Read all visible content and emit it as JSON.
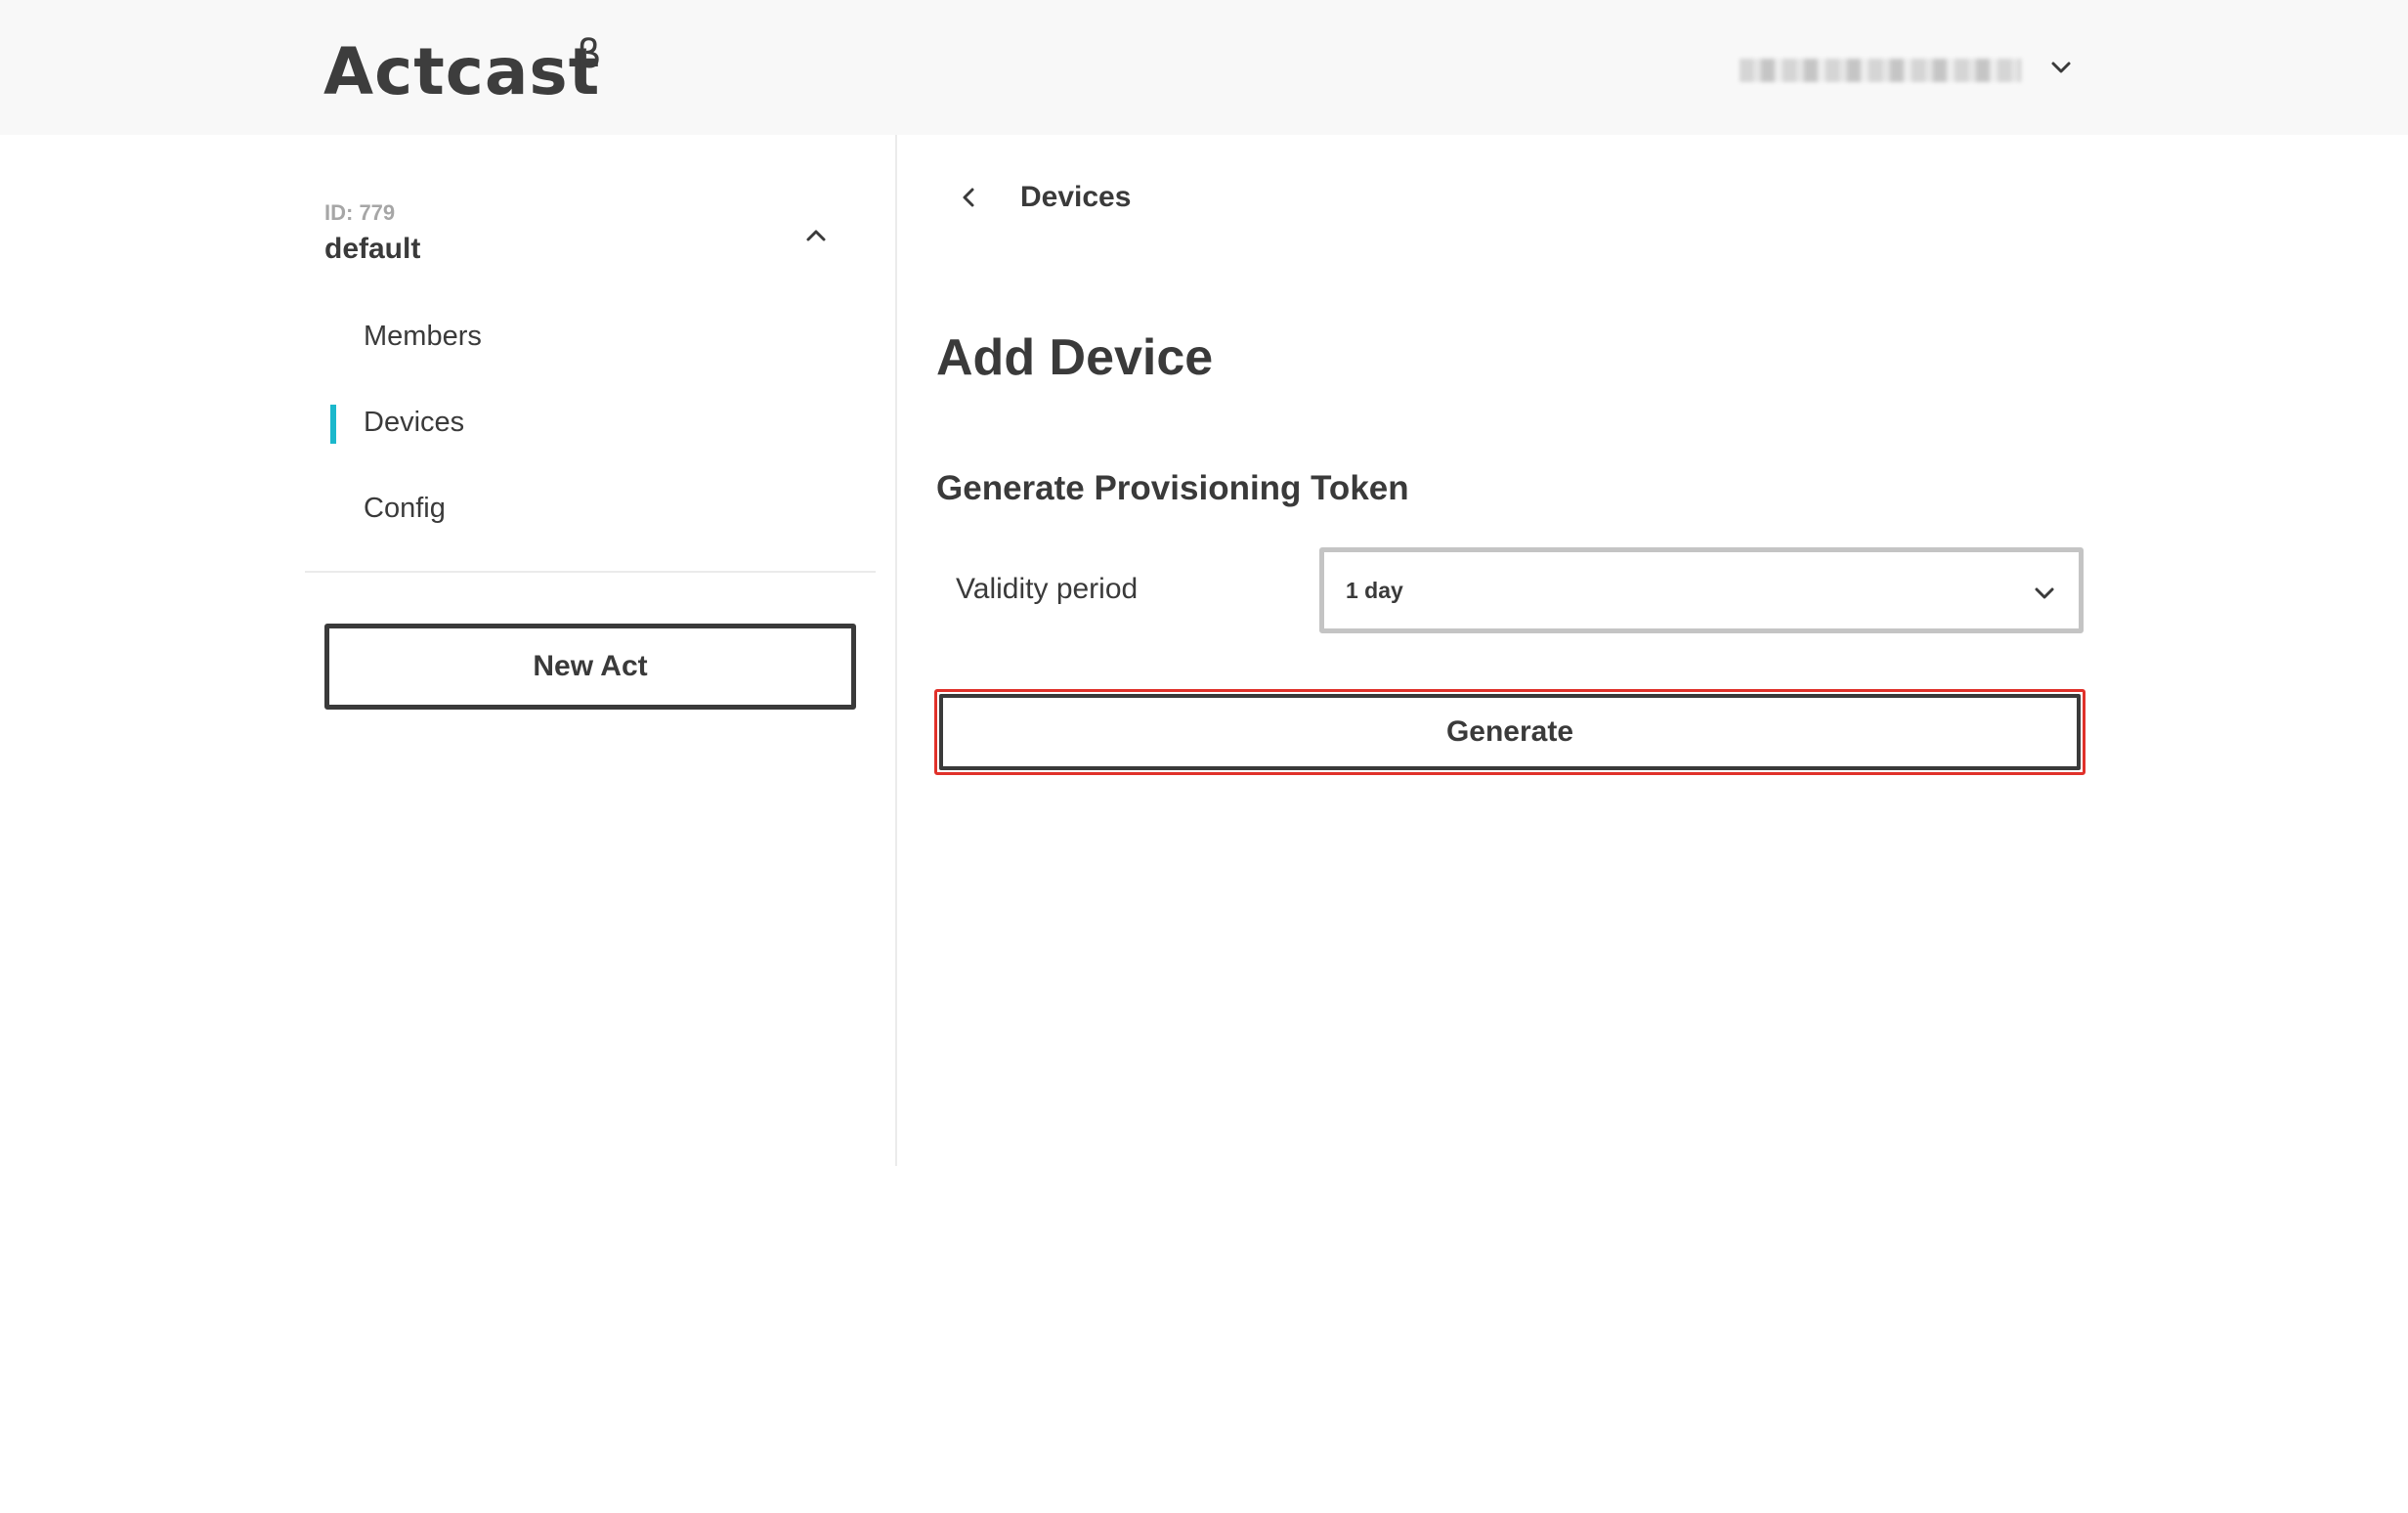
{
  "header": {
    "logo_text": "Actcast",
    "logo_beta": "β",
    "user_menu_icon": "chevron-down-icon"
  },
  "sidebar": {
    "group_id": "ID: 779",
    "group_name": "default",
    "group_toggle_icon": "chevron-up-icon",
    "items": [
      {
        "label": "Members",
        "active": false
      },
      {
        "label": "Devices",
        "active": true
      },
      {
        "label": "Config",
        "active": false
      }
    ],
    "new_act_label": "New Act",
    "active_indicator_color": "#1bb8cc"
  },
  "main": {
    "back_label": "Devices",
    "back_icon": "chevron-left-icon",
    "title": "Add Device",
    "section_title": "Generate Provisioning Token",
    "validity_label": "Validity period",
    "validity_value": "1 day",
    "select_icon": "chevron-down-icon",
    "generate_label": "Generate",
    "highlight_color": "#e0312a"
  }
}
